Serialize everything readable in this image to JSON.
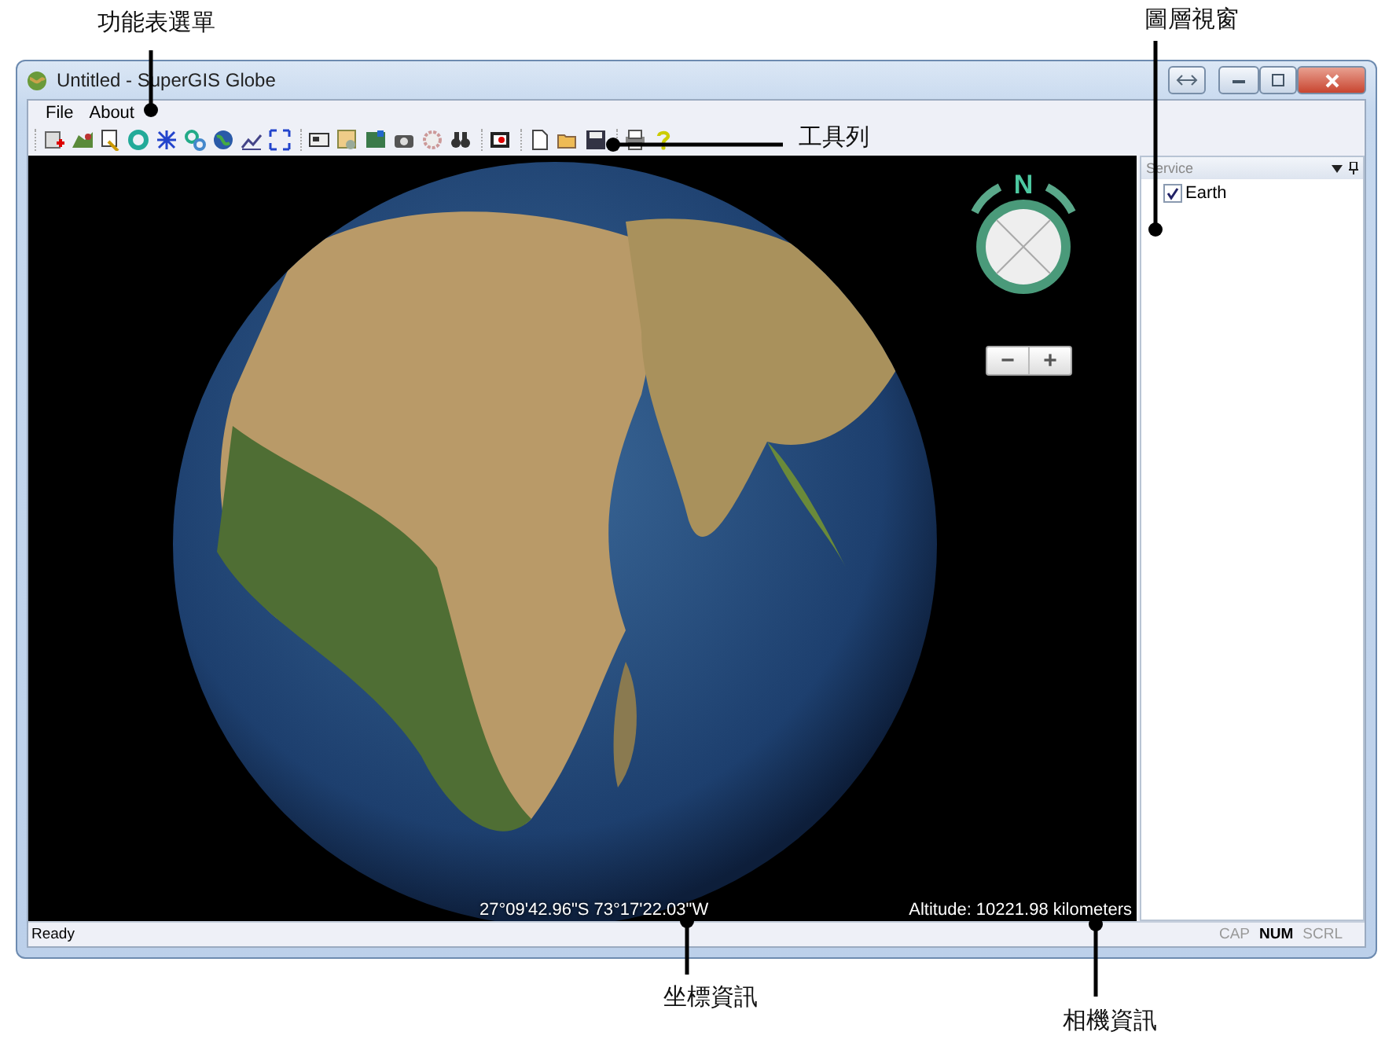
{
  "annotations": [
    {
      "label": "功能表選單"
    },
    {
      "label": "圖層視窗"
    },
    {
      "label": "工具列"
    },
    {
      "label": "坐標資訊"
    },
    {
      "label": "相機資訊"
    }
  ],
  "window": {
    "title": "Untitled - SuperGIS Globe"
  },
  "menu": [
    {
      "label": "File"
    },
    {
      "label": "About"
    }
  ],
  "globe": {
    "compass_label": "N",
    "zoom_out": "−",
    "zoom_in": "+",
    "coordinates": "27°09'42.96\"S 73°17'22.03\"W",
    "altitude": "Altitude: 10221.98 kilometers"
  },
  "layer_panel": {
    "title": "Service",
    "layers": [
      {
        "name": "Earth",
        "checked": true
      }
    ]
  },
  "status_bar": {
    "text": "Ready",
    "indicators": [
      {
        "label": "CAP",
        "on": false
      },
      {
        "label": "NUM",
        "on": true
      },
      {
        "label": "SCRL",
        "on": false
      }
    ]
  }
}
